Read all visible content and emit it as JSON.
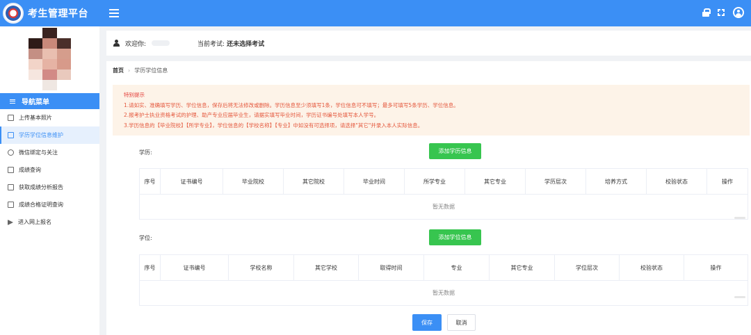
{
  "app": {
    "title": "考生管理平台",
    "brand_color": "#3b8ff5"
  },
  "topbar": {
    "icons": [
      "menu-icon",
      "lock-icon",
      "fullscreen-icon",
      "user-avatar-icon"
    ]
  },
  "sidebar": {
    "nav_header": "导航菜单",
    "items": [
      {
        "label": "上传基本照片",
        "icon": "image-icon",
        "active": false
      },
      {
        "label": "学历学位信息维护",
        "icon": "book-icon",
        "active": true
      },
      {
        "label": "微信绑定与关注",
        "icon": "wechat-icon",
        "active": false
      },
      {
        "label": "成绩查询",
        "icon": "document-icon",
        "active": false
      },
      {
        "label": "获取成绩分析报告",
        "icon": "report-icon",
        "active": false
      },
      {
        "label": "成绩合格证明查询",
        "icon": "certificate-icon",
        "active": false
      },
      {
        "label": "进入网上报名",
        "icon": "send-icon",
        "active": false
      }
    ]
  },
  "welcome": {
    "greeting": "欢迎你:",
    "exam_label": "当前考试:",
    "exam_value": "还未选择考试"
  },
  "breadcrumb": {
    "home": "首页",
    "current": "学历学位信息"
  },
  "notice": {
    "title": "特别提示",
    "lines": [
      "1.请如实、准确填写学历、学位信息，保存后将无法修改或删除。学历信息至少须填写1条，学位信息可不填写；最多可填写5条学历、学位信息。",
      "2.报考护士执业资格考试的护理、助产专业应届毕业生，请据实填写毕业时间，学历证书编号处填写本人学号。",
      "3.学历信息的【毕业院校】【所学专业】，学位信息的【学校名称】【专业】中如没有可选择项，请选择\"其它\"并录入本人实际信息。"
    ]
  },
  "education": {
    "label": "学历:",
    "add_button": "添加学历信息",
    "columns": [
      "序号",
      "证书编号",
      "毕业院校",
      "其它院校",
      "毕业时间",
      "所学专业",
      "其它专业",
      "学历层次",
      "培养方式",
      "校验状态",
      "操作"
    ],
    "empty_text": "暂无数据"
  },
  "degree": {
    "label": "学位:",
    "add_button": "添加学位信息",
    "columns": [
      "序号",
      "证书编号",
      "学校名称",
      "其它学校",
      "取得时间",
      "专业",
      "其它专业",
      "学位层次",
      "校验状态",
      "操作"
    ],
    "empty_text": "暂无数据"
  },
  "actions": {
    "save": "保存",
    "cancel": "取消"
  }
}
